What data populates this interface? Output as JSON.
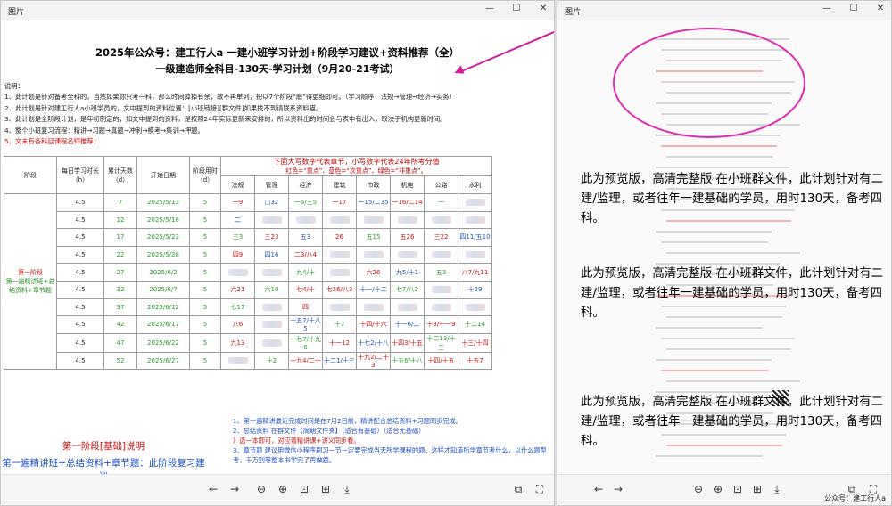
{
  "left_window": {
    "title": "图片",
    "controls": [
      "—",
      "☐",
      "✕"
    ],
    "doc": {
      "title": "2025年公众号：建工行人a 一建小班学习计划+阶段学习建议+资料推荐（全）",
      "subtitle": "一级建造师全科目-130天-学习计划（9月20-21考试）",
      "notes": [
        "说明：",
        "1、此计划是针对备考全科的，当然如果你只考一科，那么时间掉掉有余，故不再单列，把以7个阶段“磨”得更细即可。（学习顺序：法规→管理→经济→实务）",
        "2、此计划是针对建工行人a小班学员的，文中提到的资料位置：[小班链接][群文件]如果找不到请联系资料猫。",
        "3、此计划是全阶段计划，是年初制定的，如文中提到的资料，是按照24年实际更新来安排的，所以资料出的时间会与表中有出入，取决于机构更新时间。",
        "4、整个小班复习流程：精讲→习题→真题→冲刺→模考→集训→押题。",
        "5、文末有各科目课程名师推荐！"
      ],
      "table": {
        "header_line1": "下面大写数字代表章节，小写数字代表24年所考分值",
        "header_line2": "红色=“重点”、蓝色=“次重点”、绿色=“非重点”。",
        "cols": [
          "阶段",
          "每日学习时长（h）",
          "累计天数（d）",
          "开始日期",
          "阶段用时（d）"
        ],
        "subjects": [
          "法规",
          "管理",
          "经济",
          "建筑",
          "市政",
          "机电",
          "公路",
          "水利"
        ],
        "phase_label": "第一阶段",
        "phase_sub": "第一遍精讲班+总结资料+章节题",
        "rows": [
          {
            "h": "4.5",
            "days": "7",
            "date": "2025/5/13",
            "use": "5",
            "cells": [
              "一9",
              "□32",
              "一6/三5",
              "一17",
              "一15/二35",
              "一16/二14",
              "一",
              ""
            ]
          },
          {
            "h": "4.5",
            "days": "12",
            "date": "2025/5/18",
            "use": "5",
            "cells": [
              "二",
              "",
              "",
              "",
              "",
              "",
              "",
              ""
            ]
          },
          {
            "h": "4.5",
            "days": "17",
            "date": "2025/5/23",
            "use": "5",
            "cells": [
              "三3",
              "三23",
              "五3",
              "26",
              "五15",
              "五26",
              "三22",
              "四11/五10"
            ]
          },
          {
            "h": "4.5",
            "days": "22",
            "date": "2025/5/28",
            "use": "5",
            "cells": [
              "四9",
              "四16",
              "二3/八4",
              "",
              "",
              "",
              "",
              ""
            ]
          },
          {
            "h": "4.5",
            "days": "27",
            "date": "2025/6/2",
            "use": "5",
            "cells": [
              "",
              "",
              "九4/十",
              "",
              "六26",
              "九5/十1",
              "五3",
              "八7/九11"
            ]
          },
          {
            "h": "4.5",
            "days": "32",
            "date": "2025/6/7",
            "use": "5",
            "cells": [
              "六21",
              "六10",
              "七4/十",
              "七26/八3",
              "十一/十二",
              "七7/八2",
              "",
              "十29"
            ]
          },
          {
            "h": "4.5",
            "days": "37",
            "date": "2025/6/12",
            "use": "5",
            "cells": [
              "七17",
              "",
              "四",
              "",
              "",
              "",
              "",
              ""
            ]
          },
          {
            "h": "4.5",
            "days": "42",
            "date": "2025/6/17",
            "use": "5",
            "cells": [
              "八6",
              "",
              "十五7/十八5",
              "十7",
              "十四/十六",
              "十一6/二",
              "十3/十一9",
              "十二14"
            ]
          },
          {
            "h": "4.5",
            "days": "47",
            "date": "2025/6/22",
            "use": "5",
            "cells": [
              "九13",
              "",
              "十七7/十九6",
              "十一12",
              "十七2/十八",
              "十四3/十五",
              "十二13/十三",
              "十三/十四"
            ]
          },
          {
            "h": "4.5",
            "days": "52",
            "date": "2025/6/27",
            "use": "5",
            "cells": [
              "",
              "十2",
              "十九4/二十",
              "十二1/十三",
              "十九2/二十3",
              "十五6/十八",
              "十四/十五",
              "十五7"
            ]
          }
        ]
      },
      "phase_desc_title": "第一阶段[基础]说明",
      "phase_desc_sub": "第一遍精讲班+总结资料+章节题：此阶段复习建议",
      "stage_notes": [
        "1、第一遍精讲最近完成时间是在7月2日前，精讲配合总结资料+习题同步完成。",
        "2、总结资料 在群文件【简期文件夹】（适合有基础）（适合无基础）",
        "》选一本即可，对应着精讲课+讲义同步看。",
        "3、章节题 建议用微信小程序刷习一节一定要完成当天所学课程的题，这样才知道所学章节考什么，以什么题型考，千万别等整本书学完了再做题。"
      ]
    }
  },
  "right_window": {
    "title": "图片",
    "controls": [
      "—",
      "☐",
      "✕"
    ],
    "overlay_text": "此为预览版，高清完整版 在小班群文件，此计划针对有二建/监理，或者往年一建基础的学员，用时130天，备考四科。",
    "watermark": "公众号：建工行人a"
  },
  "toolbar_icons": [
    "arrow-left-icon",
    "arrow-right-icon",
    "zoom-out-icon",
    "zoom-in-icon",
    "fit-screen-icon",
    "actual-size-icon",
    "download-icon",
    "share-icon",
    "fullscreen-icon"
  ]
}
